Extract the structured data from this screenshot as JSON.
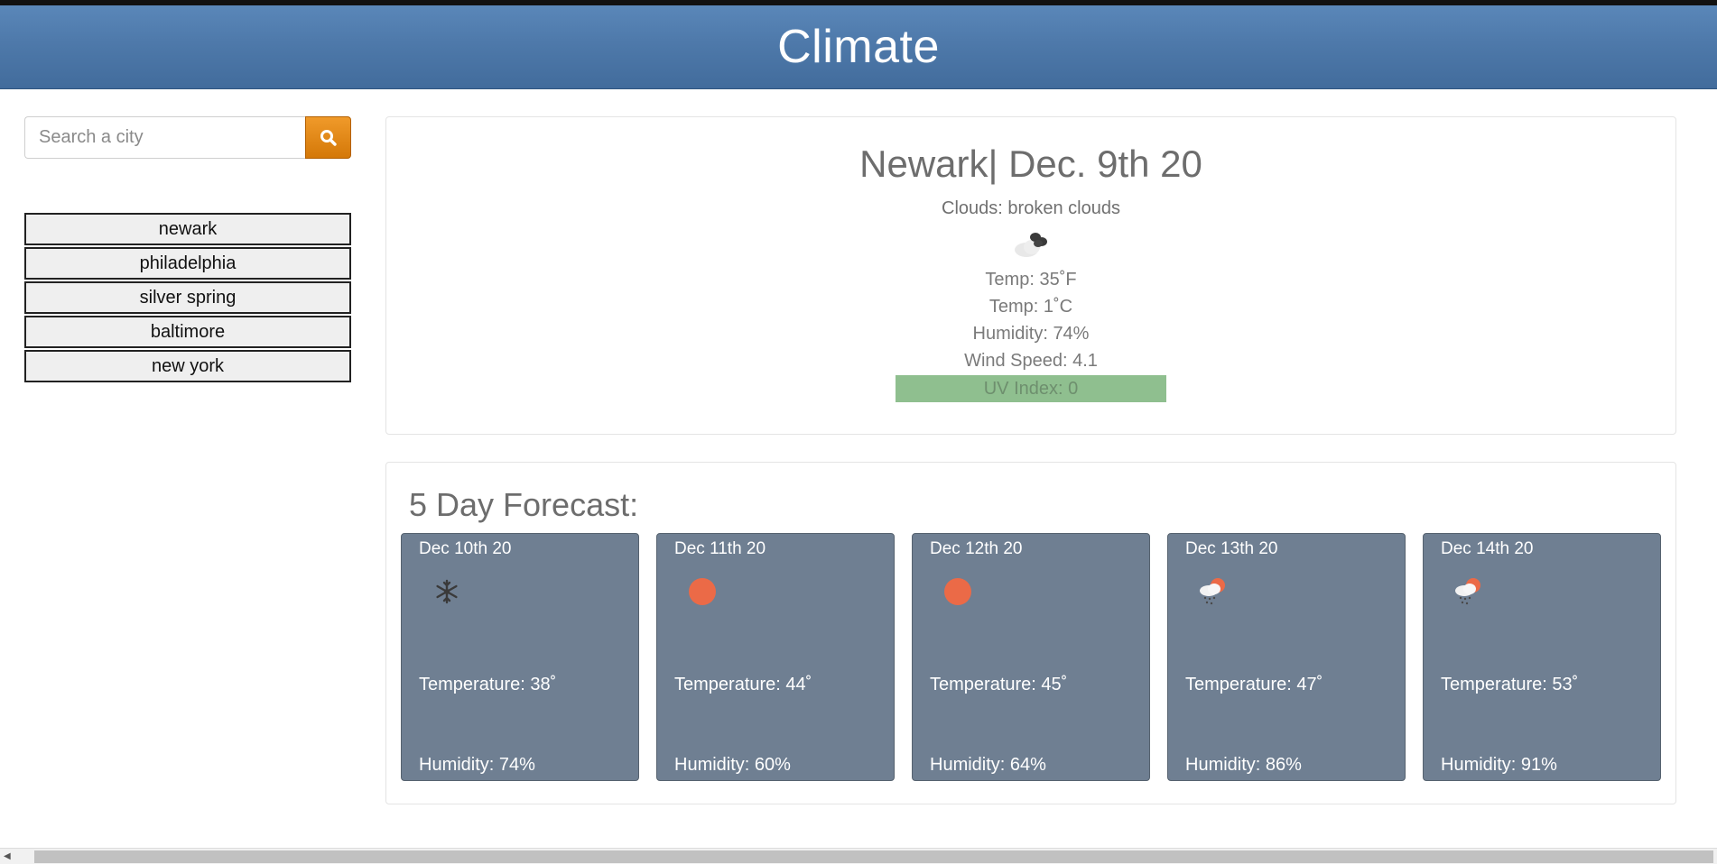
{
  "header": {
    "title": "Climate"
  },
  "search": {
    "placeholder": "Search a city",
    "button_icon": "search-icon"
  },
  "sidebar": {
    "cities": [
      {
        "label": "newark"
      },
      {
        "label": "philadelphia"
      },
      {
        "label": "silver spring"
      },
      {
        "label": "baltimore"
      },
      {
        "label": "new york"
      }
    ]
  },
  "current": {
    "title": "Newark| Dec. 9th 20",
    "description": "Clouds: broken clouds",
    "icon": "broken-clouds-icon",
    "temp_f": "Temp: 35˚F",
    "temp_c": "Temp: 1˚C",
    "humidity": "Humidity: 74%",
    "wind": "Wind Speed: 4.1",
    "uv": "UV Index: 0",
    "uv_color": "#8fbf8f"
  },
  "forecast": {
    "heading": "5 Day Forecast:",
    "days": [
      {
        "date": "Dec 10th 20",
        "icon": "snow-icon",
        "temp": "Temperature: 38˚",
        "humidity": "Humidity: 74%"
      },
      {
        "date": "Dec 11th 20",
        "icon": "sun-icon",
        "temp": "Temperature: 44˚",
        "humidity": "Humidity: 60%"
      },
      {
        "date": "Dec 12th 20",
        "icon": "sun-icon",
        "temp": "Temperature: 45˚",
        "humidity": "Humidity: 64%"
      },
      {
        "date": "Dec 13th 20",
        "icon": "rain-sun-icon",
        "temp": "Temperature: 47˚",
        "humidity": "Humidity: 86%"
      },
      {
        "date": "Dec 14th 20",
        "icon": "rain-sun-icon",
        "temp": "Temperature: 53˚",
        "humidity": "Humidity: 91%"
      }
    ]
  },
  "colors": {
    "header": "#4e79aa",
    "accent": "#e88a12",
    "card": "#6f7f92"
  }
}
